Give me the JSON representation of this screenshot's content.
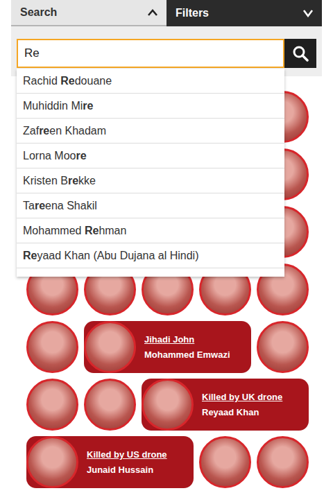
{
  "tabs": [
    {
      "label": "Search",
      "selected": true,
      "expanded": true
    },
    {
      "label": "Filters",
      "selected": false,
      "expanded": false
    }
  ],
  "search": {
    "value": "Re"
  },
  "suggestions": [
    {
      "parts": [
        {
          "text": "Rachid ",
          "bold": false
        },
        {
          "text": "Re",
          "bold": true
        },
        {
          "text": "douane",
          "bold": false
        }
      ]
    },
    {
      "parts": [
        {
          "text": "Muhiddin Mi",
          "bold": false
        },
        {
          "text": "re",
          "bold": true
        }
      ]
    },
    {
      "parts": [
        {
          "text": "Zaf",
          "bold": false
        },
        {
          "text": "re",
          "bold": true
        },
        {
          "text": "en Khadam",
          "bold": false
        }
      ]
    },
    {
      "parts": [
        {
          "text": "Lorna Moo",
          "bold": false
        },
        {
          "text": "re",
          "bold": true
        }
      ]
    },
    {
      "parts": [
        {
          "text": "Kristen B",
          "bold": false
        },
        {
          "text": "re",
          "bold": true
        },
        {
          "text": "kke",
          "bold": false
        }
      ]
    },
    {
      "parts": [
        {
          "text": "Ta",
          "bold": false
        },
        {
          "text": "re",
          "bold": true
        },
        {
          "text": "ena Shakil",
          "bold": false
        }
      ]
    },
    {
      "parts": [
        {
          "text": "Mohammed ",
          "bold": false
        },
        {
          "text": "Re",
          "bold": true
        },
        {
          "text": "hman",
          "bold": false
        }
      ]
    },
    {
      "parts": [
        {
          "text": "Re",
          "bold": true
        },
        {
          "text": "yaad Khan (Abu Dujana al Hindi)",
          "bold": false
        }
      ]
    }
  ],
  "people": [
    {
      "kind": "avatar"
    },
    {
      "kind": "avatar"
    },
    {
      "kind": "avatar"
    },
    {
      "kind": "avatar"
    },
    {
      "kind": "avatar"
    },
    {
      "kind": "avatar"
    },
    {
      "kind": "avatar"
    },
    {
      "kind": "avatar"
    },
    {
      "kind": "avatar"
    },
    {
      "kind": "avatar"
    },
    {
      "kind": "avatar"
    },
    {
      "kind": "avatar"
    },
    {
      "kind": "avatar"
    },
    {
      "kind": "avatar"
    },
    {
      "kind": "avatar"
    },
    {
      "kind": "avatar"
    },
    {
      "kind": "avatar"
    },
    {
      "kind": "avatar"
    },
    {
      "kind": "avatar"
    },
    {
      "kind": "avatar"
    },
    {
      "kind": "avatar"
    },
    {
      "kind": "card",
      "label": "Jihadi John",
      "name": "Mohammed Emwazi"
    },
    {
      "kind": "avatar"
    },
    {
      "kind": "avatar"
    },
    {
      "kind": "avatar"
    },
    {
      "kind": "card",
      "label": "Killed by UK drone",
      "name": "Reyaad Khan"
    },
    {
      "kind": "card",
      "label": "Killed by US drone",
      "name": "Junaid Hussain"
    },
    {
      "kind": "avatar"
    },
    {
      "kind": "avatar"
    }
  ]
}
